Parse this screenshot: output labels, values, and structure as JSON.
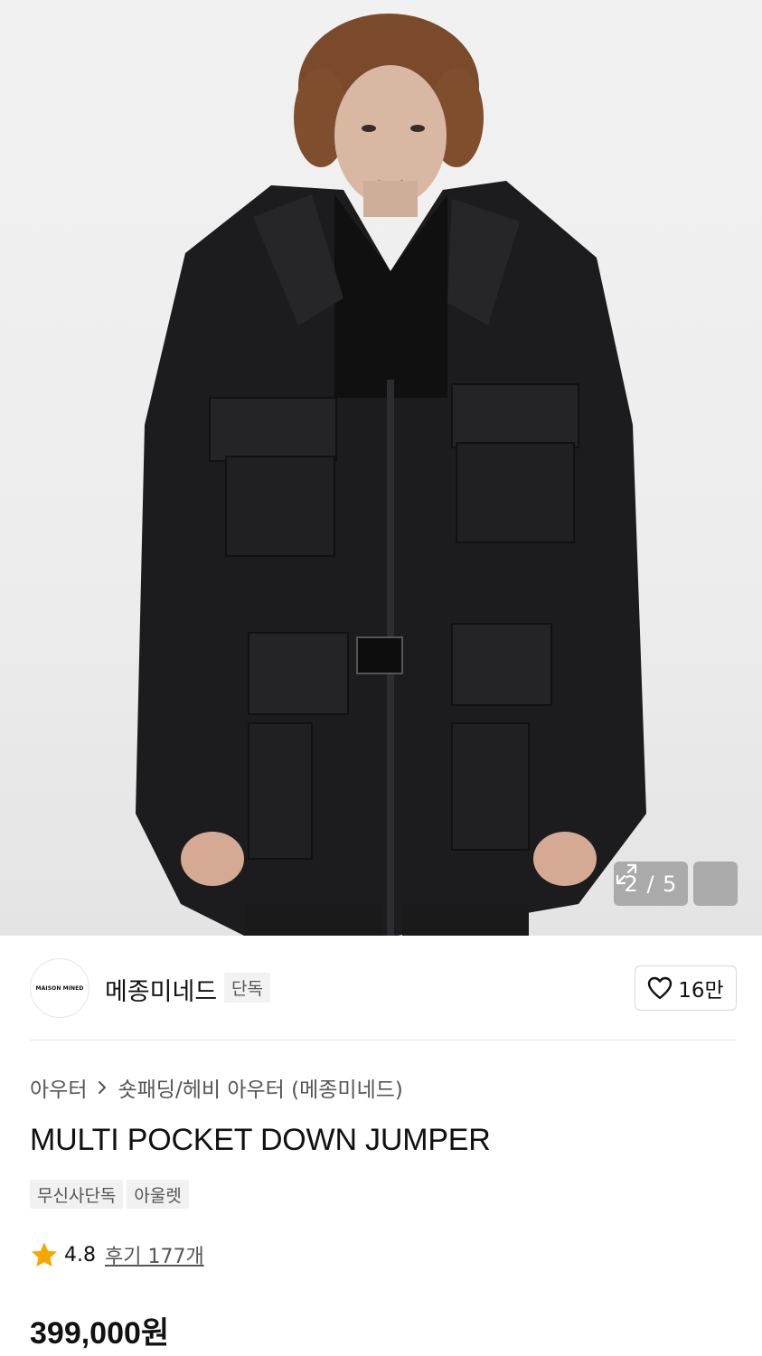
{
  "image": {
    "counter": "2 / 5",
    "expand_icon": "expand-icon"
  },
  "brand": {
    "logo_text": "MAISON MINED",
    "name": "메종미네드",
    "badge": "단독",
    "likes": "16만"
  },
  "breadcrumb": {
    "category": "아우터",
    "subcategory": "숏패딩/헤비 아우터 (메종미네드)"
  },
  "product": {
    "title": "MULTI POCKET DOWN JUMPER",
    "tags": [
      "무신사단독",
      "아울렛"
    ],
    "rating": "4.8",
    "reviews": "후기 177개",
    "price": "399,000원"
  },
  "colors": {
    "star": "#f7a600",
    "text": "#111111",
    "muted": "#555555"
  }
}
